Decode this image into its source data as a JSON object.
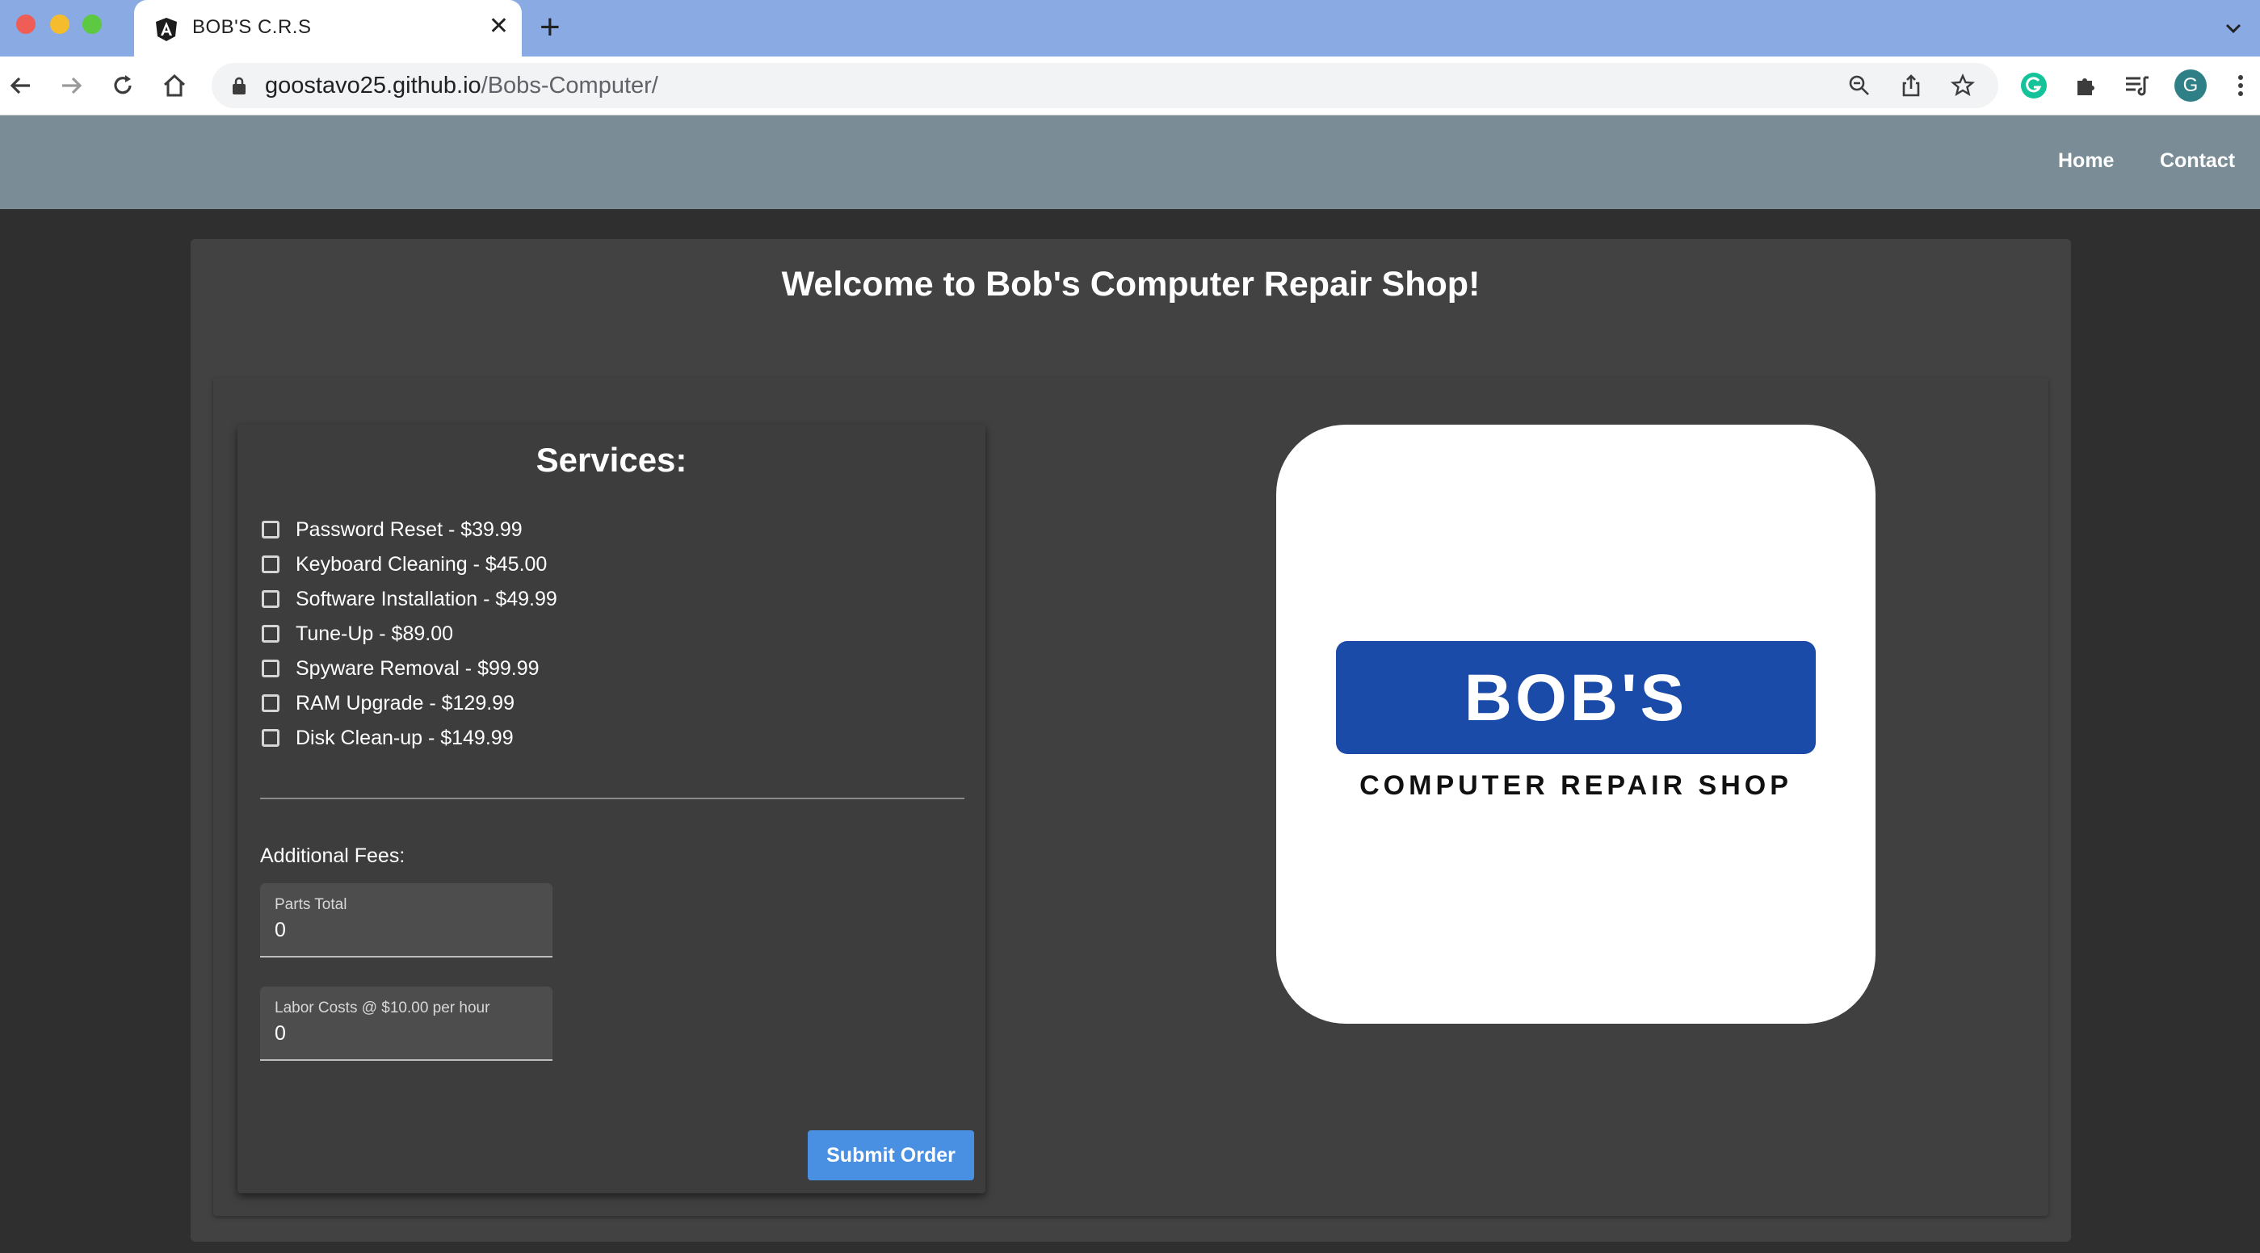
{
  "browser": {
    "tab_title": "BOB'S C.R.S",
    "url_host": "goostavo25.github.io",
    "url_path": "/Bobs-Computer/",
    "profile_initial": "G"
  },
  "nav": {
    "home": "Home",
    "contact": "Contact"
  },
  "page": {
    "welcome": "Welcome to Bob's Computer Repair Shop!"
  },
  "services": {
    "title": "Services:",
    "items": [
      {
        "label": "Password Reset - $39.99",
        "checked": false
      },
      {
        "label": "Keyboard Cleaning - $45.00",
        "checked": false
      },
      {
        "label": "Software Installation - $49.99",
        "checked": false
      },
      {
        "label": "Tune-Up - $89.00",
        "checked": false
      },
      {
        "label": "Spyware Removal - $99.99",
        "checked": false
      },
      {
        "label": "RAM Upgrade - $129.99",
        "checked": false
      },
      {
        "label": "Disk Clean-up - $149.99",
        "checked": false
      }
    ]
  },
  "fees": {
    "title": "Additional Fees:",
    "parts_label": "Parts Total",
    "parts_value": "0",
    "labor_label": "Labor Costs @ $10.00 per hour",
    "labor_value": "0"
  },
  "actions": {
    "submit": "Submit Order"
  },
  "logo": {
    "name": "BOB'S",
    "subtitle": "COMPUTER REPAIR SHOP"
  },
  "colors": {
    "header": "#7a8d97",
    "background": "#2f2f2f",
    "card": "#424242",
    "button": "#4a90e2",
    "logo_banner": "#1b4ba8"
  }
}
